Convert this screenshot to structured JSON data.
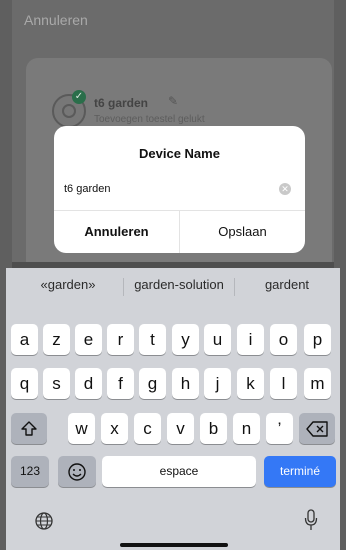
{
  "app": {
    "top_cancel": "Annuleren",
    "device_title": "t6 garden",
    "device_subtitle": "Toevoegen toestel gelukt"
  },
  "dialog": {
    "title": "Device Name",
    "input_value": "t6 garden",
    "cancel_label": "Annuleren",
    "save_label": "Opslaan"
  },
  "keyboard": {
    "suggestions": [
      "«garden»",
      "garden-solution",
      "gardent"
    ],
    "row1": [
      "a",
      "z",
      "e",
      "r",
      "t",
      "y",
      "u",
      "i",
      "o",
      "p"
    ],
    "row2": [
      "q",
      "s",
      "d",
      "f",
      "g",
      "h",
      "j",
      "k",
      "l",
      "m"
    ],
    "row3": [
      "w",
      "x",
      "c",
      "v",
      "b",
      "n",
      "’"
    ],
    "numbers_label": "123",
    "space_label": "espace",
    "done_label": "terminé"
  },
  "colors": {
    "done_key": "#3478f6",
    "keyboard_bg": "#d1d3d8",
    "dim_overlay": "#6b6b6b"
  }
}
